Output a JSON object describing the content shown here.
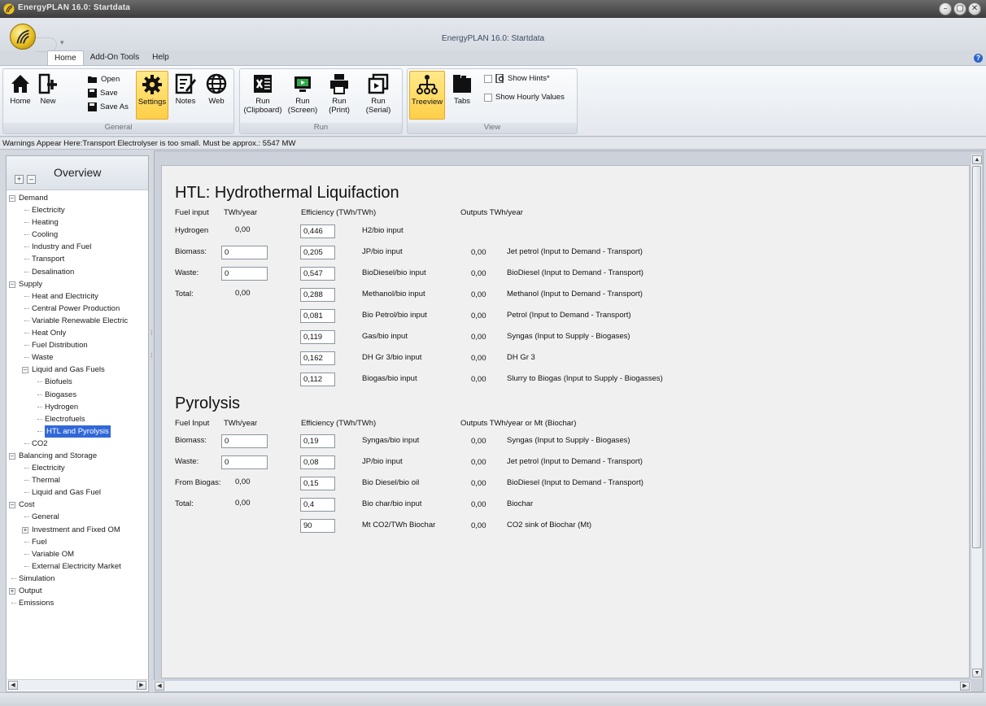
{
  "window": {
    "title": "EnergyPLAN 16.0: Startdata",
    "doc_title": "EnergyPLAN 16.0: Startdata",
    "buttons": [
      "–",
      "▢",
      "✕"
    ]
  },
  "tabs": [
    "Home",
    "Add-On Tools",
    "Help"
  ],
  "ribbon": {
    "general": {
      "label": "General",
      "home": "Home",
      "new": "New",
      "open": "Open",
      "save": "Save",
      "save_as": "Save As",
      "settings": "Settings",
      "notes": "Notes",
      "web": "Web"
    },
    "run": {
      "label": "Run",
      "clipboard": [
        "Run",
        "(Clipboard)"
      ],
      "screen": [
        "Run",
        "(Screen)"
      ],
      "print": [
        "Run",
        "(Print)"
      ],
      "serial": [
        "Run",
        "(Serial)"
      ]
    },
    "view": {
      "label": "View",
      "treeview": "Treeview",
      "tabs": "Tabs",
      "show_hints": "Show Hints*",
      "show_hourly": "Show Hourly Values"
    }
  },
  "warning": "Warnings Appear Here:Transport Electrolyser is too small. Must be approx.: 5547 MW",
  "overview": {
    "title": "Overview",
    "tree": [
      {
        "label": "Demand",
        "level": 0,
        "toggle": "–"
      },
      {
        "label": "Electricity",
        "level": 1
      },
      {
        "label": "Heating",
        "level": 1
      },
      {
        "label": "Cooling",
        "level": 1
      },
      {
        "label": "Industry and Fuel",
        "level": 1
      },
      {
        "label": "Transport",
        "level": 1
      },
      {
        "label": "Desalination",
        "level": 1
      },
      {
        "label": "Supply",
        "level": 0,
        "toggle": "–"
      },
      {
        "label": "Heat and Electricity",
        "level": 1
      },
      {
        "label": "Central Power Production",
        "level": 1
      },
      {
        "label": "Variable Renewable Electric",
        "level": 1
      },
      {
        "label": "Heat Only",
        "level": 1
      },
      {
        "label": "Fuel Distribution",
        "level": 1
      },
      {
        "label": "Waste",
        "level": 1
      },
      {
        "label": "Liquid and Gas Fuels",
        "level": 1,
        "toggle": "–"
      },
      {
        "label": "Biofuels",
        "level": 2
      },
      {
        "label": "Biogases",
        "level": 2
      },
      {
        "label": "Hydrogen",
        "level": 2
      },
      {
        "label": "Electrofuels",
        "level": 2
      },
      {
        "label": "HTL and Pyrolysis",
        "level": 2,
        "selected": true
      },
      {
        "label": "CO2",
        "level": 1
      },
      {
        "label": "Balancing and Storage",
        "level": 0,
        "toggle": "–"
      },
      {
        "label": "Electricity",
        "level": 1
      },
      {
        "label": "Thermal",
        "level": 1
      },
      {
        "label": "Liquid and Gas Fuel",
        "level": 1
      },
      {
        "label": "Cost",
        "level": 0,
        "toggle": "–"
      },
      {
        "label": "General",
        "level": 1
      },
      {
        "label": "Investment and Fixed OM",
        "level": 1,
        "toggle": "+"
      },
      {
        "label": "Fuel",
        "level": 1
      },
      {
        "label": "Variable OM",
        "level": 1
      },
      {
        "label": "External Electricity Market",
        "level": 1
      },
      {
        "label": "Simulation",
        "level": 0
      },
      {
        "label": "Output",
        "level": 0,
        "toggle": "+"
      },
      {
        "label": "Emissions",
        "level": 0
      }
    ]
  },
  "htl": {
    "title": "HTL: Hydrothermal Liquifaction",
    "hdr_fuel": "Fuel input",
    "hdr_twh": "TWh/year",
    "hdr_eff": "Efficiency  (TWh/TWh)",
    "hdr_out": "Outputs  TWh/year",
    "inputs": [
      {
        "label": "Hydrogen",
        "value": "0,00",
        "is_field": false
      },
      {
        "label": "Biomass:",
        "value": "0",
        "is_field": true
      },
      {
        "label": "Waste:",
        "value": "0",
        "is_field": true
      },
      {
        "label": "Total:",
        "value": "0,00",
        "is_field": false
      }
    ],
    "rows": [
      {
        "eff": "0,446",
        "desc": "H2/bio input",
        "out": "",
        "out_desc": ""
      },
      {
        "eff": "0,205",
        "desc": "JP/bio input",
        "out": "0,00",
        "out_desc": "Jet petrol (Input to Demand - Transport)"
      },
      {
        "eff": "0,547",
        "desc": "BioDiesel/bio input",
        "out": "0,00",
        "out_desc": "BioDiesel (Input to Demand - Transport)"
      },
      {
        "eff": "0,288",
        "desc": "Methanol/bio input",
        "out": "0,00",
        "out_desc": "Methanol (Input to Demand - Transport)"
      },
      {
        "eff": "0,081",
        "desc": "Bio Petrol/bio input",
        "out": "0,00",
        "out_desc": "Petrol (Input to Demand - Transport)"
      },
      {
        "eff": "0,119",
        "desc": "Gas/bio input",
        "out": "0,00",
        "out_desc": "Syngas (Input to Supply - Biogases)"
      },
      {
        "eff": "0,162",
        "desc": "DH Gr 3/bio input",
        "out": "0,00",
        "out_desc": "DH Gr 3"
      },
      {
        "eff": "0,112",
        "desc": "Biogas/bio input",
        "out": "0,00",
        "out_desc": "Slurry to Biogas (Input to Supply - Biogasses)"
      }
    ]
  },
  "pyrolysis": {
    "title": "Pyrolysis",
    "hdr_fuel": "Fuel Input",
    "hdr_twh": "TWh/year",
    "hdr_eff": "Efficiency  (TWh/TWh)",
    "hdr_out": "Outputs  TWh/year or Mt (Biochar)",
    "inputs": [
      {
        "label": "Biomass:",
        "value": "0",
        "is_field": true
      },
      {
        "label": "Waste:",
        "value": "0",
        "is_field": true
      },
      {
        "label": "From Biogas:",
        "value": "0,00",
        "is_field": false
      },
      {
        "label": "Total:",
        "value": "0,00",
        "is_field": false
      }
    ],
    "rows": [
      {
        "eff": "0,19",
        "desc": "Syngas/bio input",
        "out": "0,00",
        "out_desc": "Syngas (Input to Supply - Biogases)"
      },
      {
        "eff": "0,08",
        "desc": "JP/bio input",
        "out": "0,00",
        "out_desc": "Jet petrol (Input to Demand - Transport)"
      },
      {
        "eff": "0,15",
        "desc": "Bio Diesel/bio oil",
        "out": "0,00",
        "out_desc": "BioDiesel (Input to Demand - Transport)"
      },
      {
        "eff": "0,4",
        "desc": "Bio char/bio input",
        "out": "0,00",
        "out_desc": "Biochar"
      },
      {
        "eff": "90",
        "desc": "Mt CO2/TWh Biochar",
        "out": "0,00",
        "out_desc": "CO2 sink of Biochar (Mt)"
      }
    ]
  },
  "colors": {
    "selected_tree": "#3168d8",
    "ribbon_selected": "#ffcf47",
    "help_icon": "#2a62c8"
  }
}
